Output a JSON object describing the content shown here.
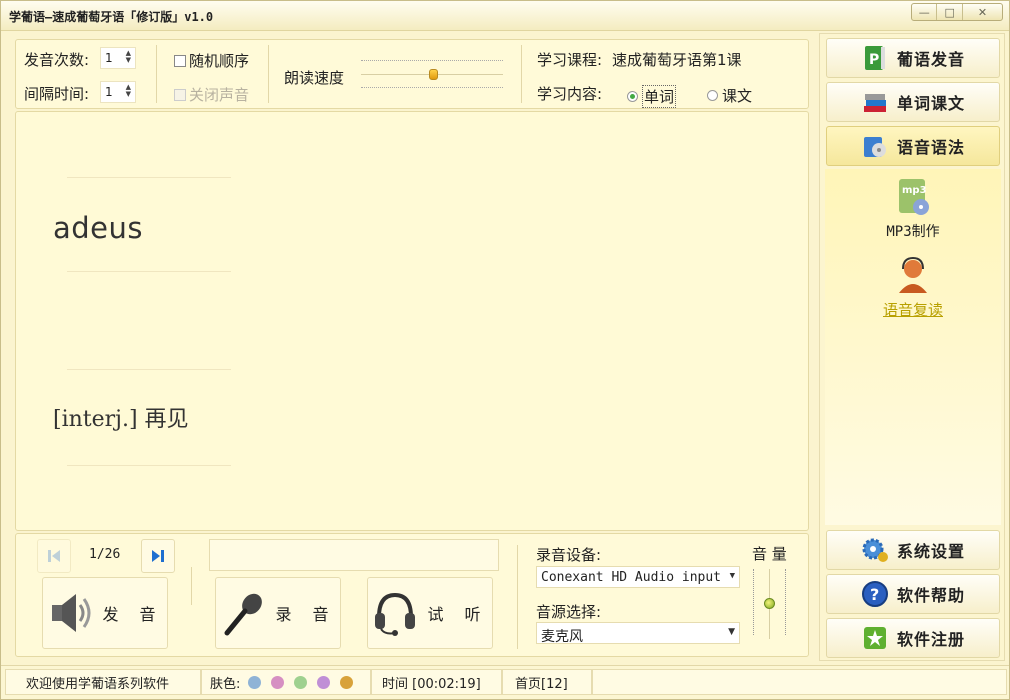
{
  "window": {
    "title": "学葡语—速成葡萄牙语「修订版」v1.0",
    "min": "—",
    "max": "□",
    "close": "✕"
  },
  "controls": {
    "repeat_label": "发音次数:",
    "repeat_value": "1",
    "interval_label": "间隔时间:",
    "interval_value": "1",
    "random_label": "随机顺序",
    "mute_label": "关闭声音",
    "speed_label": "朗读速度",
    "course_label": "学习课程:",
    "course_value": "速成葡萄牙语第1课",
    "content_label": "学习内容:",
    "content_options": [
      "单词",
      "课文"
    ],
    "content_selected": "单词"
  },
  "display": {
    "word": "adeus",
    "meaning": "[interj.] 再见"
  },
  "bottom": {
    "page": "1/26",
    "speak_label": "发 音",
    "record_label": "录 音",
    "listen_label": "试 听",
    "device_label": "录音设备:",
    "device_value": "Conexant HD Audio input",
    "source_label": "音源选择:",
    "source_value": "麦克风",
    "volume_label": "音 量"
  },
  "sidebar": {
    "top": [
      {
        "label": "葡语发音",
        "icon": "book-p-icon"
      },
      {
        "label": "单词课文",
        "icon": "books-icon"
      },
      {
        "label": "语音语法",
        "icon": "audio-grammar-icon"
      }
    ],
    "tools": [
      {
        "label": "MP3制作",
        "icon": "mp3-icon"
      },
      {
        "label": "语音复读",
        "icon": "headset-person-icon"
      }
    ],
    "bottom": [
      {
        "label": "系统设置",
        "icon": "gear-icon"
      },
      {
        "label": "软件帮助",
        "icon": "help-icon"
      },
      {
        "label": "软件注册",
        "icon": "register-icon"
      }
    ]
  },
  "status": {
    "welcome": "欢迎使用学葡语系列软件",
    "skin_label": "肤色:",
    "skin_colors": [
      "#8fb3d6",
      "#d68fc2",
      "#9fd18f",
      "#c08fd6",
      "#d8a23a"
    ],
    "time": "时间 [00:02:19]",
    "home": "首页[12]"
  }
}
